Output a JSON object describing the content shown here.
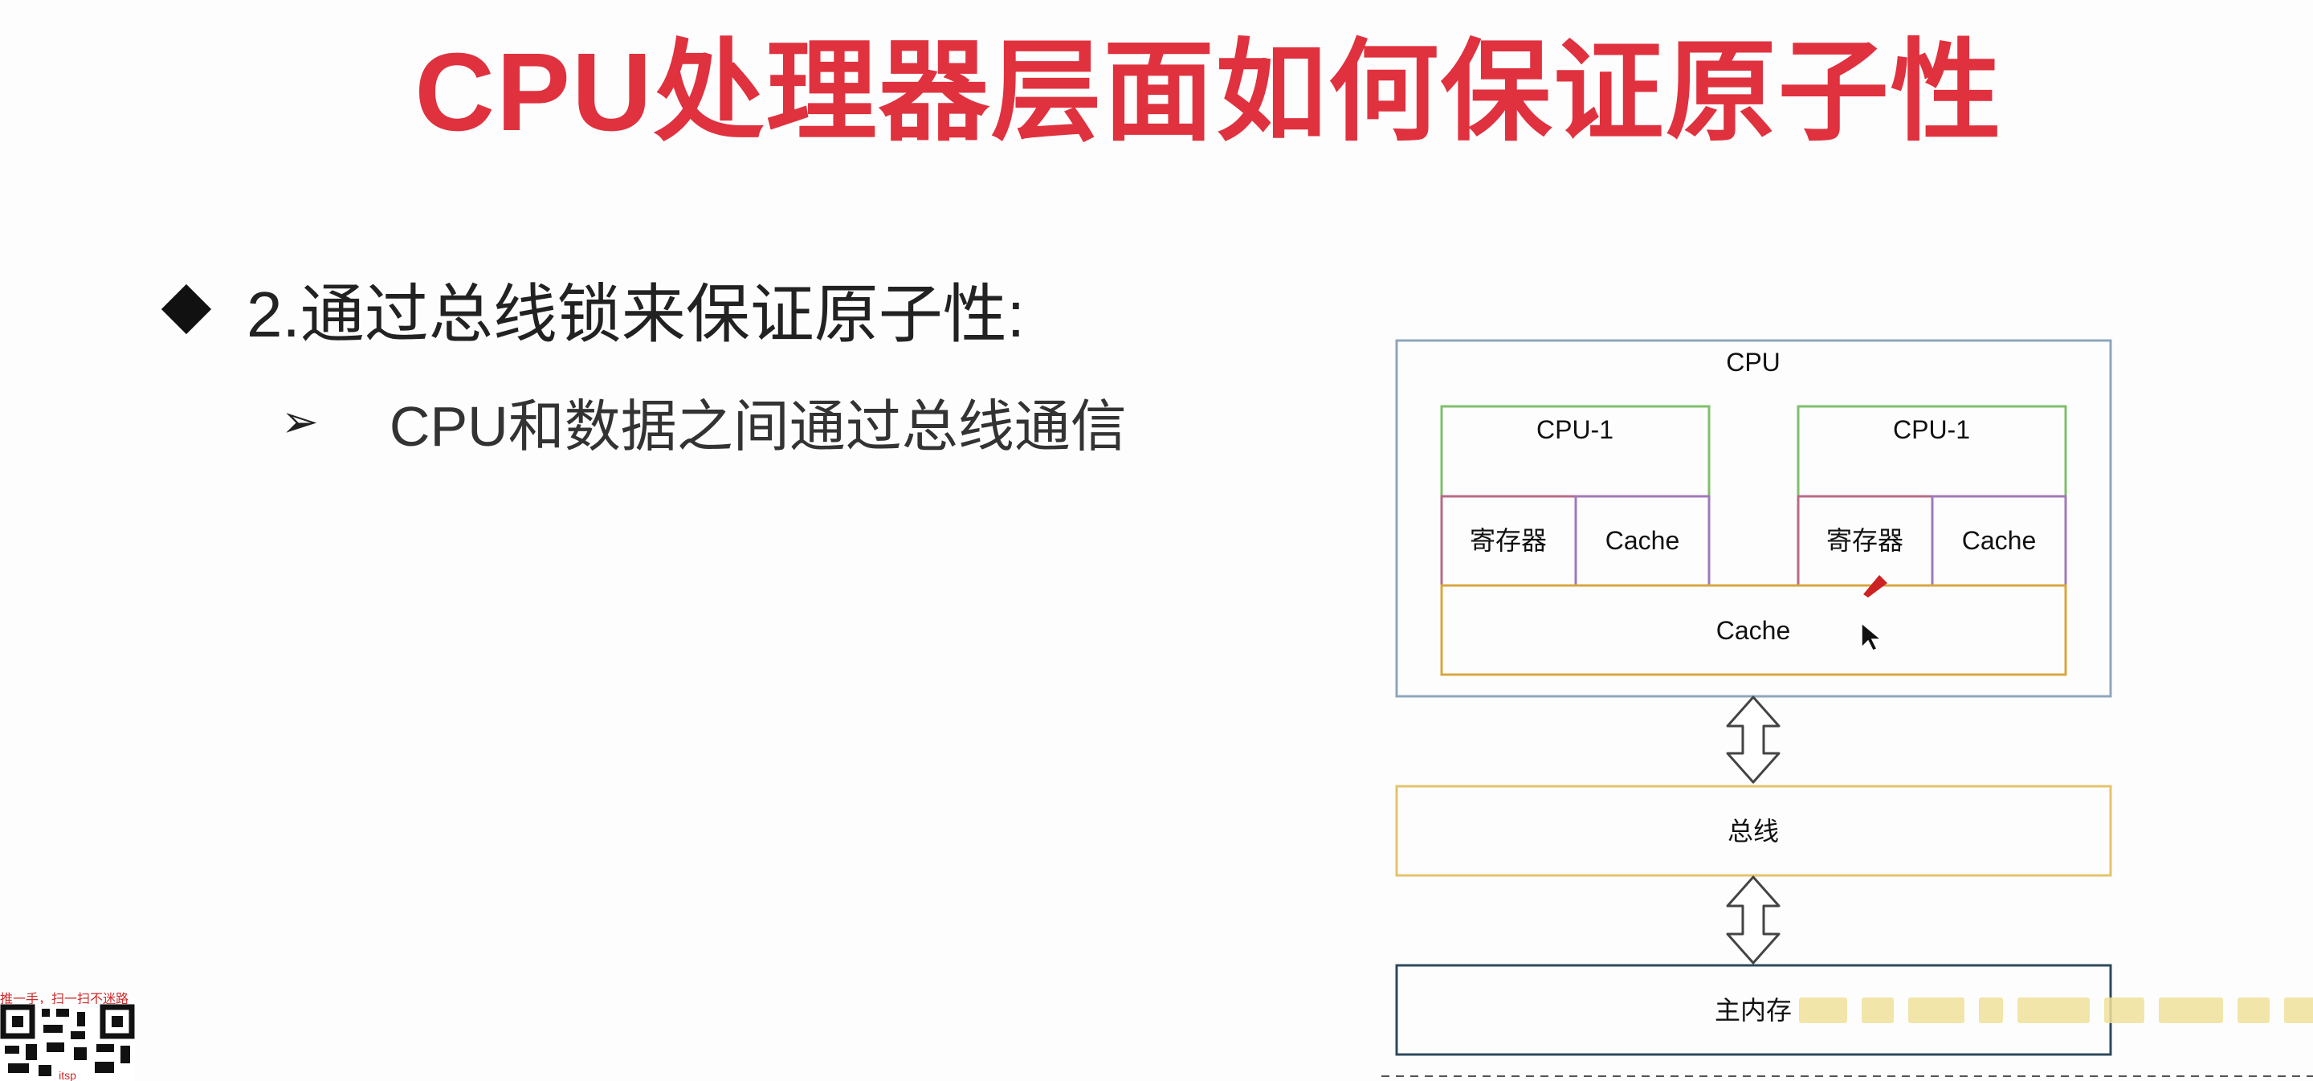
{
  "slide": {
    "title": "CPU处理器层面如何保证原子性",
    "bullets": [
      {
        "level": 1,
        "marker": "diamond-icon",
        "text": "2.通过总线锁来保证原子性:"
      },
      {
        "level": 2,
        "marker": "arrow-icon",
        "text": "CPU和数据之间通过总线通信"
      }
    ]
  },
  "diagram": {
    "cpu_label": "CPU",
    "cores": [
      {
        "label": "CPU-1",
        "register": "寄存器",
        "cache": "Cache"
      },
      {
        "label": "CPU-1",
        "register": "寄存器",
        "cache": "Cache"
      }
    ],
    "shared_cache": "Cache",
    "bus": "总线",
    "main_memory": "主内存",
    "colors": {
      "cpu_border": "#8fa6bb",
      "core_border": "#7fbf6a",
      "register_border": "#b86a86",
      "cache_border": "#a07ab8",
      "shared_cache_border": "#d9a640",
      "bus_border": "#e5c36a",
      "memory_border": "#2e4a5c"
    }
  },
  "watermark": {
    "caption": "推一手，扫一扫不迷路",
    "qr_text": "itsp"
  },
  "colors": {
    "title": "#e0313e",
    "text": "#222222"
  }
}
